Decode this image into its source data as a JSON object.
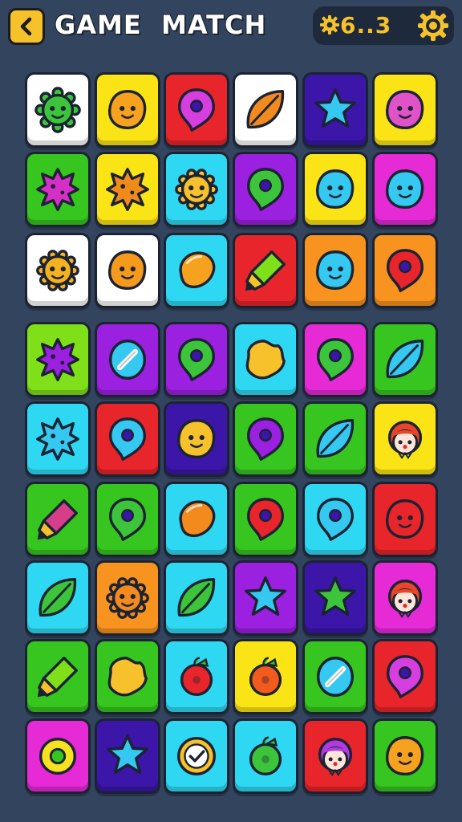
{
  "header": {
    "title": "GAME  MATCH",
    "score": "6..3",
    "back_icon": "chevron-left-icon",
    "settings_icon": "gear-icon"
  },
  "colors": {
    "background": "#33455e",
    "white": "#ffffff",
    "yellow": "#fbe416",
    "red": "#e8252a",
    "purple": "#9b20e0",
    "indigo": "#3b16a8",
    "green": "#37c51f",
    "cyan": "#2fd8f2",
    "orange": "#f7931e",
    "magenta": "#e52ad6",
    "lime": "#7fe01a"
  },
  "board": {
    "rows": [
      [
        {
          "color": "white",
          "icon": "germ-face",
          "fill": "#3cc43a"
        },
        {
          "color": "yellow",
          "icon": "blob-face",
          "fill": "#f6a21e"
        },
        {
          "color": "red",
          "icon": "drop-dot",
          "fill": "#d63ee0"
        },
        {
          "color": "white",
          "icon": "leaf",
          "fill": "#f28a1e"
        },
        {
          "color": "indigo",
          "icon": "star",
          "fill": "#35c8f0"
        },
        {
          "color": "yellow",
          "icon": "blob-face",
          "fill": "#e052c8"
        }
      ],
      [
        {
          "color": "green",
          "icon": "splat",
          "fill": "#d52fc7"
        },
        {
          "color": "yellow",
          "icon": "splat",
          "fill": "#f08a1a"
        },
        {
          "color": "cyan",
          "icon": "sun-face",
          "fill": "#f6c12a"
        },
        {
          "color": "purple",
          "icon": "drop-dot",
          "fill": "#3cc43a"
        },
        {
          "color": "yellow",
          "icon": "blob-face",
          "fill": "#35c8f0"
        },
        {
          "color": "magenta",
          "icon": "blob-face",
          "fill": "#35c8f0"
        }
      ],
      [
        {
          "color": "white",
          "icon": "sun-face",
          "fill": "#f6b21e"
        },
        {
          "color": "white",
          "icon": "blob-face",
          "fill": "#f69a1e"
        },
        {
          "color": "cyan",
          "icon": "lemon",
          "fill": "#f6a21e"
        },
        {
          "color": "red",
          "icon": "marker",
          "fill": "#7fe01a"
        },
        {
          "color": "orange",
          "icon": "blob-face",
          "fill": "#35c8f0"
        },
        {
          "color": "orange",
          "icon": "drop-dot",
          "fill": "#e8252a"
        }
      ],
      [
        {
          "color": "lime",
          "icon": "splat",
          "fill": "#9b20e0"
        },
        {
          "color": "purple",
          "icon": "pill",
          "fill": "#35c8f0"
        },
        {
          "color": "purple",
          "icon": "drop-dot",
          "fill": "#3cc43a"
        },
        {
          "color": "cyan",
          "icon": "star-blob",
          "fill": "#f6c12a"
        },
        {
          "color": "magenta",
          "icon": "drop-dot",
          "fill": "#3cc43a"
        },
        {
          "color": "green",
          "icon": "leaf",
          "fill": "#35c8f0"
        }
      ],
      [
        {
          "color": "cyan",
          "icon": "splat",
          "fill": "#35c8f0"
        },
        {
          "color": "red",
          "icon": "drop-dot",
          "fill": "#35c8f0"
        },
        {
          "color": "indigo",
          "icon": "blob-face",
          "fill": "#f6c12a"
        },
        {
          "color": "green",
          "icon": "drop-dot",
          "fill": "#9b20e0"
        },
        {
          "color": "green",
          "icon": "leaf",
          "fill": "#35c8f0"
        },
        {
          "color": "yellow",
          "icon": "girl-face",
          "fill": "#e8452a"
        }
      ],
      [
        {
          "color": "green",
          "icon": "marker",
          "fill": "#d63e8a"
        },
        {
          "color": "green",
          "icon": "drop-dot",
          "fill": "#3cc43a"
        },
        {
          "color": "cyan",
          "icon": "lemon",
          "fill": "#f28a1e"
        },
        {
          "color": "green",
          "icon": "drop-dot",
          "fill": "#e8252a"
        },
        {
          "color": "cyan",
          "icon": "drop-dot",
          "fill": "#35c8f0"
        },
        {
          "color": "red",
          "icon": "blob-face",
          "fill": "#e8252a"
        }
      ],
      [
        {
          "color": "cyan",
          "icon": "leaf",
          "fill": "#3cc43a"
        },
        {
          "color": "orange",
          "icon": "sun-face",
          "fill": "#f28a1e"
        },
        {
          "color": "cyan",
          "icon": "leaf",
          "fill": "#3cc43a"
        },
        {
          "color": "purple",
          "icon": "star",
          "fill": "#35c8f0"
        },
        {
          "color": "indigo",
          "icon": "star",
          "fill": "#3cc43a"
        },
        {
          "color": "magenta",
          "icon": "girl-face",
          "fill": "#e8452a"
        }
      ],
      [
        {
          "color": "green",
          "icon": "marker",
          "fill": "#7fe01a"
        },
        {
          "color": "green",
          "icon": "star-blob",
          "fill": "#f6c12a"
        },
        {
          "color": "cyan",
          "icon": "berry",
          "fill": "#e8252a"
        },
        {
          "color": "yellow",
          "icon": "berry",
          "fill": "#f25a1e"
        },
        {
          "color": "green",
          "icon": "pill",
          "fill": "#35c8f0"
        },
        {
          "color": "red",
          "icon": "drop-dot",
          "fill": "#d63ee0"
        }
      ],
      [
        {
          "color": "magenta",
          "icon": "ring",
          "fill": "#f6e21e"
        },
        {
          "color": "indigo",
          "icon": "star",
          "fill": "#35c8f0"
        },
        {
          "color": "cyan",
          "icon": "check-coin",
          "fill": "#f6c12a"
        },
        {
          "color": "cyan",
          "icon": "berry",
          "fill": "#3cc43a"
        },
        {
          "color": "red",
          "icon": "girl-face",
          "fill": "#b03ae0"
        },
        {
          "color": "green",
          "icon": "blob-face",
          "fill": "#f6a21e"
        }
      ]
    ]
  }
}
